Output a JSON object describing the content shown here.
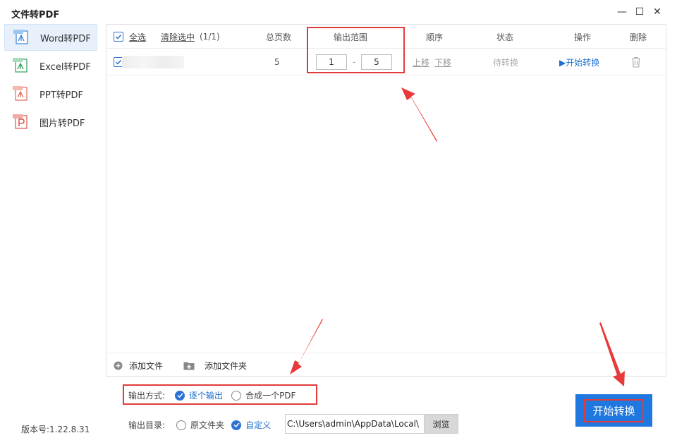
{
  "window": {
    "title": "文件转PDF",
    "min_glyph": "—",
    "max_glyph": "☐",
    "close_glyph": "✕"
  },
  "sidebar": {
    "items": [
      {
        "label": "Word转PDF",
        "icon": "word-pdf-icon",
        "active": true
      },
      {
        "label": "Excel转PDF",
        "icon": "excel-pdf-icon",
        "active": false
      },
      {
        "label": "PPT转PDF",
        "icon": "ppt-pdf-icon",
        "active": false
      },
      {
        "label": "图片转PDF",
        "icon": "image-pdf-icon",
        "active": false
      }
    ],
    "version": "版本号:1.22.8.31"
  },
  "table": {
    "select_all": "全选",
    "clear_selection": "清除选中",
    "selection_count": "(1/1)",
    "headers": {
      "pages": "总页数",
      "range": "输出范围",
      "order": "顺序",
      "status": "状态",
      "action": "操作",
      "delete": "删除"
    },
    "rows": [
      {
        "pages": "5",
        "range_from": "1",
        "range_sep": "-",
        "range_to": "5",
        "move_up": "上移",
        "move_down": "下移",
        "status": "待转换",
        "action": "▶开始转换"
      }
    ]
  },
  "footer": {
    "add_file": "添加文件",
    "add_folder": "添加文件夹"
  },
  "output": {
    "mode_label": "输出方式:",
    "mode_each": "逐个输出",
    "mode_merge": "合成一个PDF",
    "dir_label": "输出目录:",
    "dir_original": "原文件夹",
    "dir_custom": "自定义",
    "dir_path": "C:\\Users\\admin\\AppData\\Local\\",
    "browse": "浏览"
  },
  "start_button": "开始转换",
  "colors": {
    "accent": "#1f77e0",
    "highlight": "#e23b3b"
  }
}
